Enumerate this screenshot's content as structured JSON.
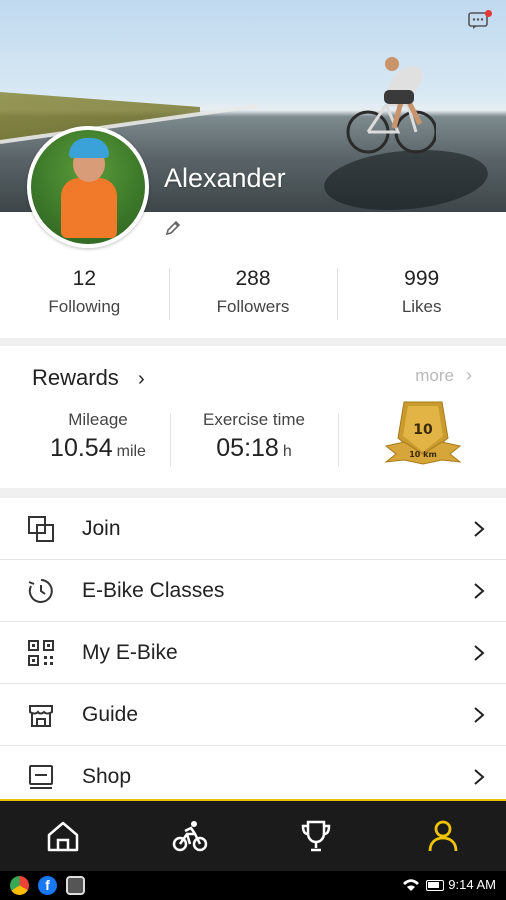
{
  "profile": {
    "name": "Alexander",
    "stats": [
      {
        "value": "12",
        "label": "Following"
      },
      {
        "value": "288",
        "label": "Followers"
      },
      {
        "value": "999",
        "label": "Likes"
      }
    ]
  },
  "rewards": {
    "title": "Rewards",
    "more_label": "more",
    "mileage": {
      "label": "Mileage",
      "value": "10.54",
      "unit": "mile"
    },
    "exercise": {
      "label": "Exercise time",
      "value": "05:18",
      "unit": "h"
    },
    "medal": {
      "number": "10",
      "distance": "10 km"
    }
  },
  "menu": [
    {
      "label": "Join",
      "icon": "join-icon"
    },
    {
      "label": "E-Bike Classes",
      "icon": "timer-icon"
    },
    {
      "label": "My E-Bike",
      "icon": "qr-code-icon"
    },
    {
      "label": "Guide",
      "icon": "store-icon"
    },
    {
      "label": "Shop",
      "icon": "shop-icon"
    }
  ],
  "tabbar": {
    "tabs": [
      "home-icon",
      "bike-rider-icon",
      "trophy-icon",
      "profile-icon"
    ],
    "active_index": 3,
    "active_color": "#f2c300",
    "icon_color": "#ffffff"
  },
  "statusbar": {
    "time": "9:14 AM",
    "apps": [
      "chrome-icon",
      "facebook-icon",
      "app-icon"
    ]
  },
  "colors": {
    "accent": "#f2c300",
    "notification_dot": "#e53935",
    "tabbar_bg": "#1b1b1b"
  }
}
